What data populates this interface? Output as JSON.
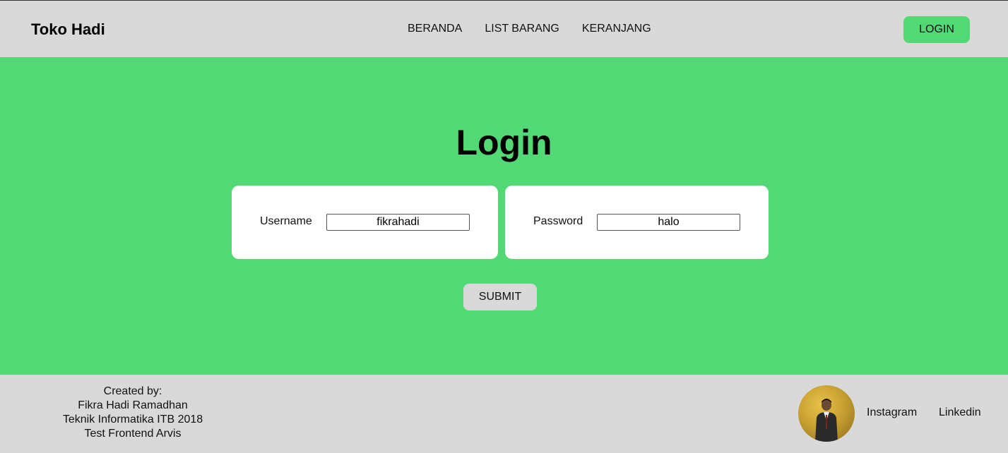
{
  "header": {
    "brand": "Toko Hadi",
    "nav": [
      "BERANDA",
      "LIST BARANG",
      "KERANJANG"
    ],
    "login_label": "LOGIN",
    "accent_color": "#52d874"
  },
  "main": {
    "title": "Login",
    "username": {
      "label": "Username",
      "value": "fikrahadi"
    },
    "password": {
      "label": "Password",
      "value": "halo"
    },
    "submit_label": "SUBMIT",
    "background_color": "#52d874"
  },
  "footer": {
    "credits": [
      "Created by:",
      "Fikra Hadi Ramadhan",
      "Teknik Informatika ITB 2018",
      "Test Frontend Arvis"
    ],
    "avatar_icon": "profile-photo",
    "links": [
      "Instagram",
      "Linkedin"
    ]
  }
}
